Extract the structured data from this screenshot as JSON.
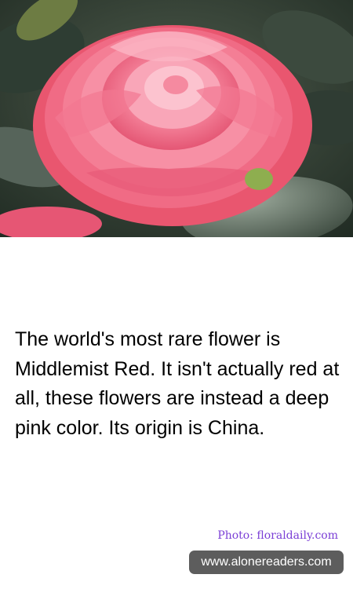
{
  "photo": {
    "subject": "camellia-flower"
  },
  "fact": {
    "text": "The world's most rare flower is Middlemist Red. It isn't actually red at all, these flowers are instead a deep pink color. Its origin is China."
  },
  "credit": {
    "text": "Photo: floraldaily.com"
  },
  "site": {
    "text": "www.alonereaders.com"
  },
  "colors": {
    "credit": "#7b3fd6",
    "badge_bg": "#5d5d5d",
    "flower": "#ef5f7e"
  }
}
